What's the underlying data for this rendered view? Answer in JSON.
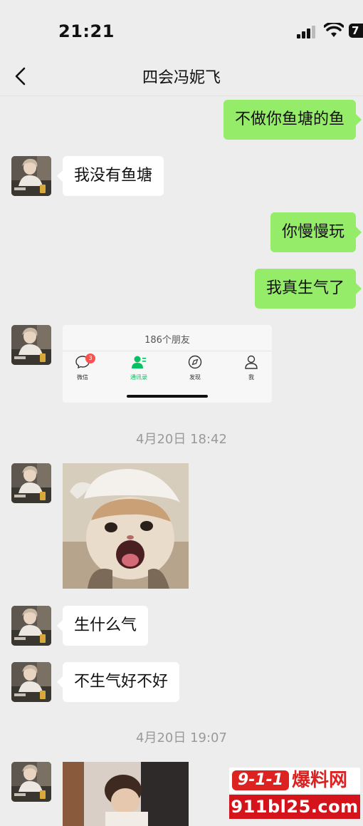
{
  "status_bar": {
    "time": "21:21",
    "battery": "7"
  },
  "header": {
    "title": "四会冯妮飞"
  },
  "messages": {
    "m1": "不做你鱼塘的鱼",
    "m2": "我没有鱼塘",
    "m3": "你慢慢玩",
    "m4": "我真生气了",
    "m6": "生什么气",
    "m7": "不生气好不好"
  },
  "screenshot_card": {
    "title": "186个朋友",
    "tabs": [
      {
        "label": "微信",
        "badge": "3",
        "icon": "chat-bubble-icon"
      },
      {
        "label": "通讯录",
        "icon": "contacts-icon"
      },
      {
        "label": "发现",
        "icon": "compass-icon"
      },
      {
        "label": "我",
        "icon": "person-icon"
      }
    ]
  },
  "timestamps": {
    "t1": "4月20日 18:42",
    "t2": "4月20日 19:07"
  },
  "watermark": {
    "badge": "9-1-1",
    "brand": "爆料网",
    "domain": "911bl25.com"
  },
  "colors": {
    "sent_bubble": "#95ec69",
    "received_bubble": "#ffffff",
    "background": "#ededed",
    "accent_green": "#07c160",
    "watermark_red": "#d4141a"
  }
}
